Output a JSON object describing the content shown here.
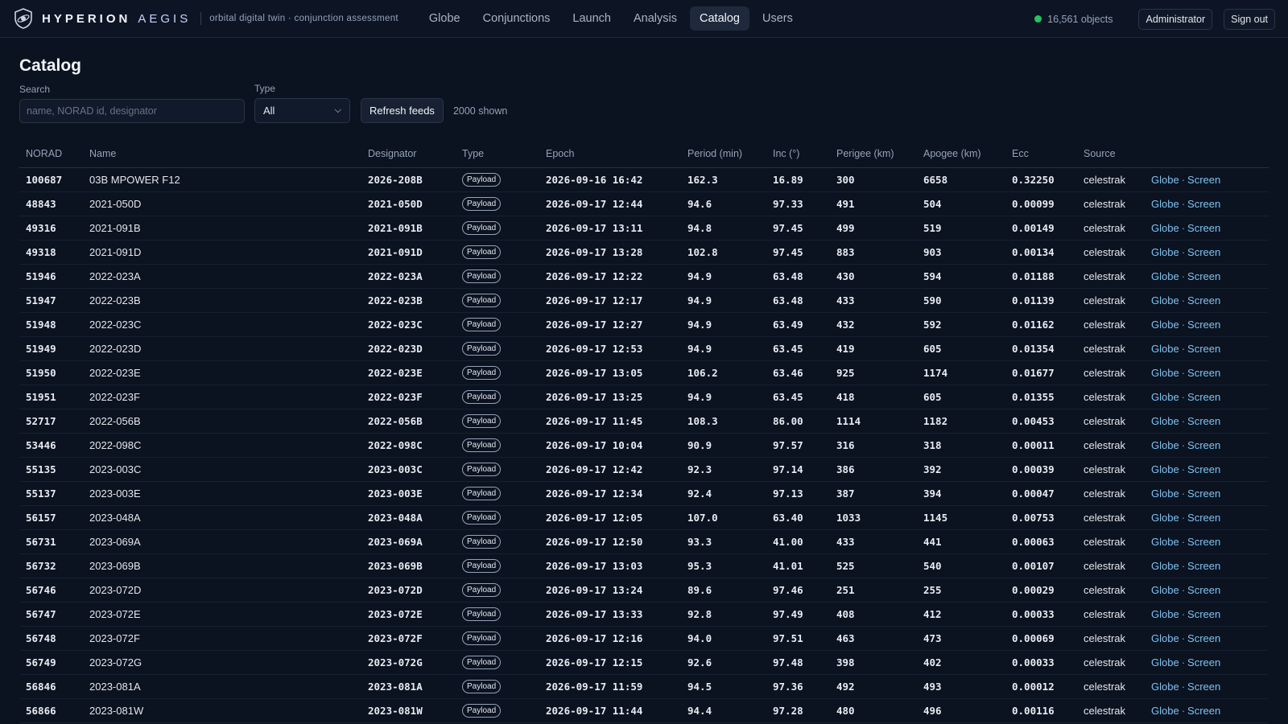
{
  "header": {
    "brand_primary": "HYPERION",
    "brand_secondary": "AEGIS",
    "tagline": "orbital digital twin · conjunction assessment",
    "nav": [
      {
        "label": "Globe",
        "active": false
      },
      {
        "label": "Conjunctions",
        "active": false
      },
      {
        "label": "Launch",
        "active": false
      },
      {
        "label": "Analysis",
        "active": false
      },
      {
        "label": "Catalog",
        "active": true
      },
      {
        "label": "Users",
        "active": false
      }
    ],
    "status_text": "16,561 objects",
    "user_label": "Administrator",
    "signout_label": "Sign out"
  },
  "page": {
    "title": "Catalog",
    "search_label": "Search",
    "search_placeholder": "name, NORAD id, designator",
    "search_value": "",
    "type_label": "Type",
    "type_value": "All",
    "refresh_label": "Refresh feeds",
    "shown_text": "2000 shown"
  },
  "table": {
    "columns": [
      "NORAD",
      "Name",
      "Designator",
      "Type",
      "Epoch",
      "Period (min)",
      "Inc (°)",
      "Perigee (km)",
      "Apogee (km)",
      "Ecc",
      "Source",
      ""
    ],
    "link_globe": "Globe",
    "link_screen": "Screen",
    "link_sep": "·",
    "rows": [
      {
        "norad": "100687",
        "name": "03B MPOWER F12",
        "designator": "2026-208B",
        "type": "Payload",
        "epoch": "2026-09-16 16:42",
        "period": "162.3",
        "inc": "16.89",
        "perigee": "300",
        "apogee": "6658",
        "ecc": "0.32250",
        "source": "celestrak"
      },
      {
        "norad": "48843",
        "name": "2021-050D",
        "designator": "2021-050D",
        "type": "Payload",
        "epoch": "2026-09-17 12:44",
        "period": "94.6",
        "inc": "97.33",
        "perigee": "491",
        "apogee": "504",
        "ecc": "0.00099",
        "source": "celestrak"
      },
      {
        "norad": "49316",
        "name": "2021-091B",
        "designator": "2021-091B",
        "type": "Payload",
        "epoch": "2026-09-17 13:11",
        "period": "94.8",
        "inc": "97.45",
        "perigee": "499",
        "apogee": "519",
        "ecc": "0.00149",
        "source": "celestrak"
      },
      {
        "norad": "49318",
        "name": "2021-091D",
        "designator": "2021-091D",
        "type": "Payload",
        "epoch": "2026-09-17 13:28",
        "period": "102.8",
        "inc": "97.45",
        "perigee": "883",
        "apogee": "903",
        "ecc": "0.00134",
        "source": "celestrak"
      },
      {
        "norad": "51946",
        "name": "2022-023A",
        "designator": "2022-023A",
        "type": "Payload",
        "epoch": "2026-09-17 12:22",
        "period": "94.9",
        "inc": "63.48",
        "perigee": "430",
        "apogee": "594",
        "ecc": "0.01188",
        "source": "celestrak"
      },
      {
        "norad": "51947",
        "name": "2022-023B",
        "designator": "2022-023B",
        "type": "Payload",
        "epoch": "2026-09-17 12:17",
        "period": "94.9",
        "inc": "63.48",
        "perigee": "433",
        "apogee": "590",
        "ecc": "0.01139",
        "source": "celestrak"
      },
      {
        "norad": "51948",
        "name": "2022-023C",
        "designator": "2022-023C",
        "type": "Payload",
        "epoch": "2026-09-17 12:27",
        "period": "94.9",
        "inc": "63.49",
        "perigee": "432",
        "apogee": "592",
        "ecc": "0.01162",
        "source": "celestrak"
      },
      {
        "norad": "51949",
        "name": "2022-023D",
        "designator": "2022-023D",
        "type": "Payload",
        "epoch": "2026-09-17 12:53",
        "period": "94.9",
        "inc": "63.45",
        "perigee": "419",
        "apogee": "605",
        "ecc": "0.01354",
        "source": "celestrak"
      },
      {
        "norad": "51950",
        "name": "2022-023E",
        "designator": "2022-023E",
        "type": "Payload",
        "epoch": "2026-09-17 13:05",
        "period": "106.2",
        "inc": "63.46",
        "perigee": "925",
        "apogee": "1174",
        "ecc": "0.01677",
        "source": "celestrak"
      },
      {
        "norad": "51951",
        "name": "2022-023F",
        "designator": "2022-023F",
        "type": "Payload",
        "epoch": "2026-09-17 13:25",
        "period": "94.9",
        "inc": "63.45",
        "perigee": "418",
        "apogee": "605",
        "ecc": "0.01355",
        "source": "celestrak"
      },
      {
        "norad": "52717",
        "name": "2022-056B",
        "designator": "2022-056B",
        "type": "Payload",
        "epoch": "2026-09-17 11:45",
        "period": "108.3",
        "inc": "86.00",
        "perigee": "1114",
        "apogee": "1182",
        "ecc": "0.00453",
        "source": "celestrak"
      },
      {
        "norad": "53446",
        "name": "2022-098C",
        "designator": "2022-098C",
        "type": "Payload",
        "epoch": "2026-09-17 10:04",
        "period": "90.9",
        "inc": "97.57",
        "perigee": "316",
        "apogee": "318",
        "ecc": "0.00011",
        "source": "celestrak"
      },
      {
        "norad": "55135",
        "name": "2023-003C",
        "designator": "2023-003C",
        "type": "Payload",
        "epoch": "2026-09-17 12:42",
        "period": "92.3",
        "inc": "97.14",
        "perigee": "386",
        "apogee": "392",
        "ecc": "0.00039",
        "source": "celestrak"
      },
      {
        "norad": "55137",
        "name": "2023-003E",
        "designator": "2023-003E",
        "type": "Payload",
        "epoch": "2026-09-17 12:34",
        "period": "92.4",
        "inc": "97.13",
        "perigee": "387",
        "apogee": "394",
        "ecc": "0.00047",
        "source": "celestrak"
      },
      {
        "norad": "56157",
        "name": "2023-048A",
        "designator": "2023-048A",
        "type": "Payload",
        "epoch": "2026-09-17 12:05",
        "period": "107.0",
        "inc": "63.40",
        "perigee": "1033",
        "apogee": "1145",
        "ecc": "0.00753",
        "source": "celestrak"
      },
      {
        "norad": "56731",
        "name": "2023-069A",
        "designator": "2023-069A",
        "type": "Payload",
        "epoch": "2026-09-17 12:50",
        "period": "93.3",
        "inc": "41.00",
        "perigee": "433",
        "apogee": "441",
        "ecc": "0.00063",
        "source": "celestrak"
      },
      {
        "norad": "56732",
        "name": "2023-069B",
        "designator": "2023-069B",
        "type": "Payload",
        "epoch": "2026-09-17 13:03",
        "period": "95.3",
        "inc": "41.01",
        "perigee": "525",
        "apogee": "540",
        "ecc": "0.00107",
        "source": "celestrak"
      },
      {
        "norad": "56746",
        "name": "2023-072D",
        "designator": "2023-072D",
        "type": "Payload",
        "epoch": "2026-09-17 13:24",
        "period": "89.6",
        "inc": "97.46",
        "perigee": "251",
        "apogee": "255",
        "ecc": "0.00029",
        "source": "celestrak"
      },
      {
        "norad": "56747",
        "name": "2023-072E",
        "designator": "2023-072E",
        "type": "Payload",
        "epoch": "2026-09-17 13:33",
        "period": "92.8",
        "inc": "97.49",
        "perigee": "408",
        "apogee": "412",
        "ecc": "0.00033",
        "source": "celestrak"
      },
      {
        "norad": "56748",
        "name": "2023-072F",
        "designator": "2023-072F",
        "type": "Payload",
        "epoch": "2026-09-17 12:16",
        "period": "94.0",
        "inc": "97.51",
        "perigee": "463",
        "apogee": "473",
        "ecc": "0.00069",
        "source": "celestrak"
      },
      {
        "norad": "56749",
        "name": "2023-072G",
        "designator": "2023-072G",
        "type": "Payload",
        "epoch": "2026-09-17 12:15",
        "period": "92.6",
        "inc": "97.48",
        "perigee": "398",
        "apogee": "402",
        "ecc": "0.00033",
        "source": "celestrak"
      },
      {
        "norad": "56846",
        "name": "2023-081A",
        "designator": "2023-081A",
        "type": "Payload",
        "epoch": "2026-09-17 11:59",
        "period": "94.5",
        "inc": "97.36",
        "perigee": "492",
        "apogee": "493",
        "ecc": "0.00012",
        "source": "celestrak"
      },
      {
        "norad": "56866",
        "name": "2023-081W",
        "designator": "2023-081W",
        "type": "Payload",
        "epoch": "2026-09-17 11:44",
        "period": "94.4",
        "inc": "97.28",
        "perigee": "480",
        "apogee": "496",
        "ecc": "0.00116",
        "source": "celestrak"
      }
    ]
  },
  "colors": {
    "background": "#0b1220",
    "accent_link": "#7cc4f2",
    "status_ok": "#22c55e",
    "active_tab": "#1e2a3b"
  },
  "icons": {
    "logo": "shield-satellite-icon",
    "status": "status-dot-icon",
    "select": "chevron-down-icon"
  }
}
